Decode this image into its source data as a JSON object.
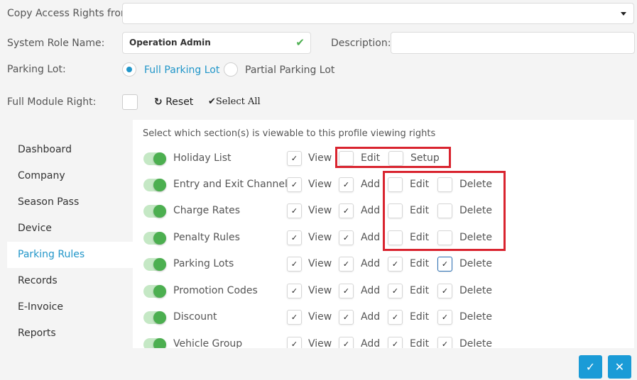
{
  "form": {
    "copy_label": "Copy Access Rights from:",
    "copy_value": "",
    "role_label": "System Role Name:",
    "role_value": "Operation Admin",
    "desc_label": "Description:",
    "desc_value": "",
    "lot_label": "Parking Lot:",
    "full_lot": "Full Parking Lot",
    "partial_lot": "Partial Parking Lot",
    "module_label": "Full Module Right:",
    "reset": "Reset",
    "select_all": "Select All"
  },
  "sidebar": [
    {
      "label": "Dashboard"
    },
    {
      "label": "Company"
    },
    {
      "label": "Season Pass"
    },
    {
      "label": "Device"
    },
    {
      "label": "Parking Rules"
    },
    {
      "label": "Records"
    },
    {
      "label": "E-Invoice"
    },
    {
      "label": "Reports"
    }
  ],
  "content": {
    "instruction": "Select which section(s) is viewable to this profile viewing rights",
    "perm_labels": {
      "view": "View",
      "add": "Add",
      "edit": "Edit",
      "setup": "Setup",
      "delete": "Delete"
    },
    "rows": [
      {
        "name": "Holiday List"
      },
      {
        "name": "Entry and Exit Channels"
      },
      {
        "name": "Charge Rates"
      },
      {
        "name": "Penalty Rules"
      },
      {
        "name": "Parking Lots"
      },
      {
        "name": "Promotion Codes"
      },
      {
        "name": "Discount"
      },
      {
        "name": "Vehicle Group"
      }
    ]
  },
  "checkmark": "✓",
  "colors": {
    "accent": "#2196c9",
    "toggle_on": "#4caf50",
    "highlight": "#d9242f",
    "button": "#1a9bd7"
  }
}
